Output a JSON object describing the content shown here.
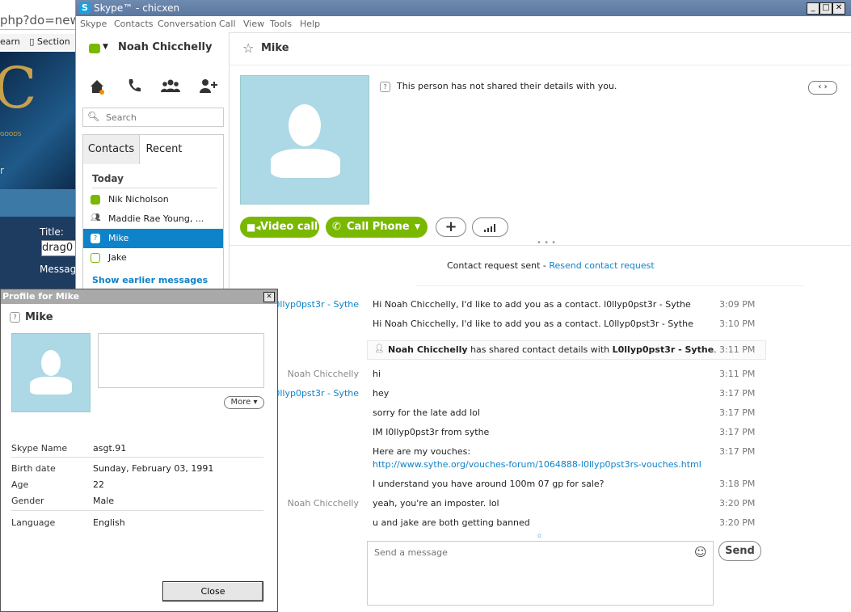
{
  "background_browser": {
    "url_fragment": "php?do=new",
    "bookmark_partial": "earn",
    "bookmark_section": "Section",
    "banner_goods": "GOODS",
    "banner_letter": "r",
    "title_label": "Title:",
    "title_value": "drag0",
    "message_label": "Messag"
  },
  "window": {
    "title": "Skype™ - chicxen",
    "logo_letter": "S",
    "menu": [
      "Skype",
      "Contacts",
      "Conversation",
      "Call",
      "View",
      "Tools",
      "Help"
    ]
  },
  "sidebar": {
    "user_name": "Noah Chicchelly",
    "search_placeholder": "Search",
    "tabs": [
      "Contacts",
      "Recent"
    ],
    "section_label": "Today",
    "contacts": [
      {
        "name": "Nik Nicholson",
        "status": "online"
      },
      {
        "name": "Maddie Rae Young, ...",
        "status": "group"
      },
      {
        "name": "Mike",
        "status": "unknown",
        "selected": true
      },
      {
        "name": "Jake",
        "status": "offline"
      }
    ],
    "show_earlier": "Show earlier messages"
  },
  "conversation": {
    "contact_name": "Mike",
    "not_shared": "This person has not shared their details with you.",
    "buttons": {
      "video_call": "Video call",
      "call_phone": "Call Phone"
    },
    "contact_request_text": "Contact request sent - ",
    "resend_link": "Resend contact request",
    "messages": [
      {
        "sender": "l0llyp0pst3r - Sythe",
        "text": "Hi Noah Chicchelly, I'd like to add you as a contact. l0llyp0pst3r - Sythe",
        "time": "3:09 PM"
      },
      {
        "sender": "",
        "text": "Hi Noah Chicchelly, I'd like to add you as a contact. L0llyp0pst3r - Sythe",
        "time": "3:10 PM"
      },
      {
        "sender": "Noah Chicchelly",
        "text": "hi",
        "time": "3:11 PM"
      },
      {
        "sender": "l0llyp0pst3r - Sythe",
        "text": "hey",
        "time": "3:17 PM"
      },
      {
        "sender": "",
        "text": "sorry for the late add lol",
        "time": "3:17 PM"
      },
      {
        "sender": "",
        "text": "IM l0llyp0pst3r from sythe",
        "time": "3:17 PM"
      },
      {
        "sender": "",
        "text": "Here are my vouches:",
        "time": "3:17 PM",
        "link": "http://www.sythe.org/vouches-forum/1064888-l0llyp0pst3rs-vouches.html"
      },
      {
        "sender": "",
        "text": "I understand you have around 100m 07 gp for sale?",
        "time": "3:18 PM"
      },
      {
        "sender": "Noah Chicchelly",
        "text": "yeah, you're an imposter. lol",
        "time": "3:20 PM"
      },
      {
        "sender": "",
        "text": "u and jake are both getting banned",
        "time": "3:20 PM"
      }
    ],
    "system_message": {
      "actor": "Noah Chicchelly",
      "middle": " has shared contact details with ",
      "target": "L0llyp0pst3r - Sythe",
      "end": ".",
      "time": "3:11 PM"
    },
    "compose_placeholder": "Send a message",
    "send_label": "Send"
  },
  "profile_dialog": {
    "title": "Profile for Mike",
    "name": "Mike",
    "more_label": "More",
    "fields": [
      {
        "label": "Skype Name",
        "value": "asgt.91"
      },
      {
        "label": "Birth date",
        "value": "Sunday, February 03, 1991"
      },
      {
        "label": "Age",
        "value": "22"
      },
      {
        "label": "Gender",
        "value": "Male"
      },
      {
        "label": "Language",
        "value": "English"
      }
    ],
    "close_label": "Close"
  },
  "colors": {
    "accent_blue": "#0e83c9",
    "online_green": "#7ab800",
    "avatar_bg": "#add8e6",
    "titlebar": "#6f8bb0"
  }
}
